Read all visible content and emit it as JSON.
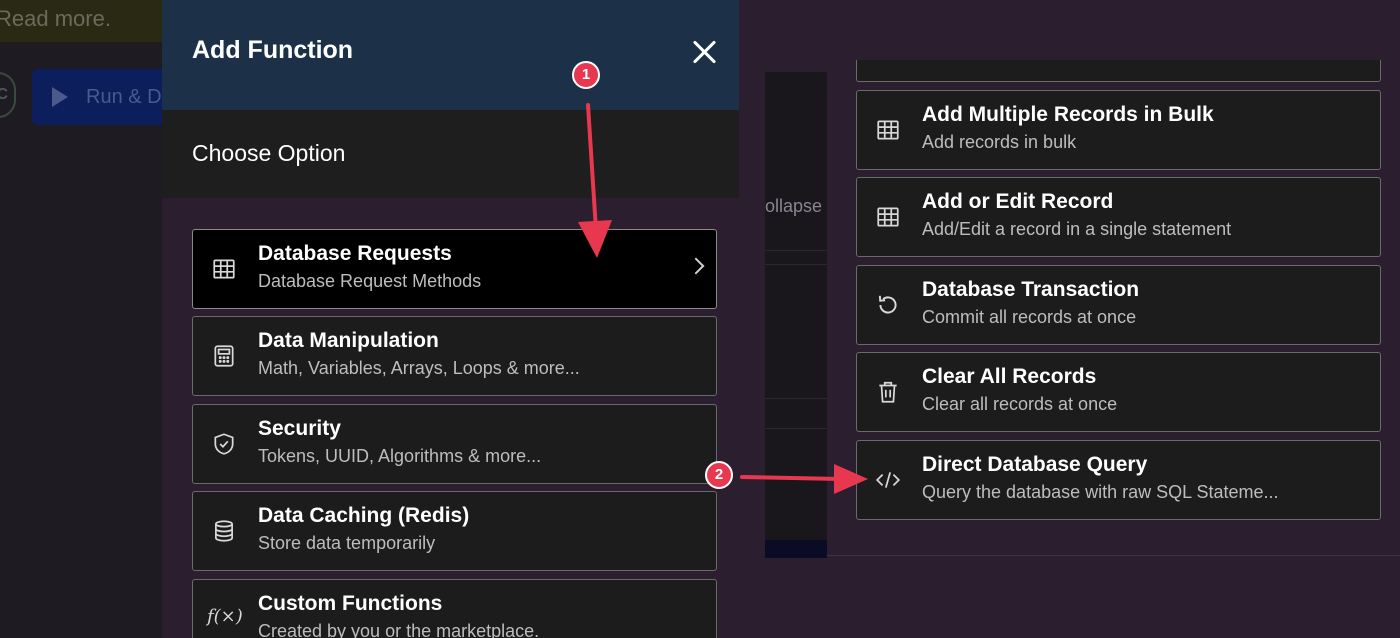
{
  "background": {
    "banner_text": "Read more.",
    "avatar_letter": "C",
    "run_button_label": "Run & D",
    "collapse_text": "ollapse"
  },
  "modal": {
    "title": "Add Function",
    "subtitle": "Choose Option",
    "options": [
      {
        "title": "Database Requests",
        "desc": "Database Request Methods",
        "icon": "table-icon"
      },
      {
        "title": "Data Manipulation",
        "desc": "Math, Variables, Arrays, Loops & more...",
        "icon": "calculator-icon"
      },
      {
        "title": "Security",
        "desc": "Tokens, UUID, Algorithms & more...",
        "icon": "shield-check-icon"
      },
      {
        "title": "Data Caching (Redis)",
        "desc": "Store data temporarily",
        "icon": "database-icon"
      },
      {
        "title": "Custom Functions",
        "desc": "Created by you or the marketplace.",
        "icon": "function-icon"
      }
    ]
  },
  "submenu": {
    "options": [
      {
        "title": "Add Multiple Records in Bulk",
        "desc": "Add records in bulk",
        "icon": "table-icon"
      },
      {
        "title": "Add or Edit Record",
        "desc": "Add/Edit a record in a single statement",
        "icon": "table-icon"
      },
      {
        "title": "Database Transaction",
        "desc": "Commit all records at once",
        "icon": "undo-icon"
      },
      {
        "title": "Clear All Records",
        "desc": "Clear all records at once",
        "icon": "trash-icon"
      },
      {
        "title": "Direct Database Query",
        "desc": "Query the database with raw SQL Stateme...",
        "icon": "code-icon"
      }
    ]
  },
  "annotations": {
    "step1": "1",
    "step2": "2",
    "color": "#e8384f"
  }
}
